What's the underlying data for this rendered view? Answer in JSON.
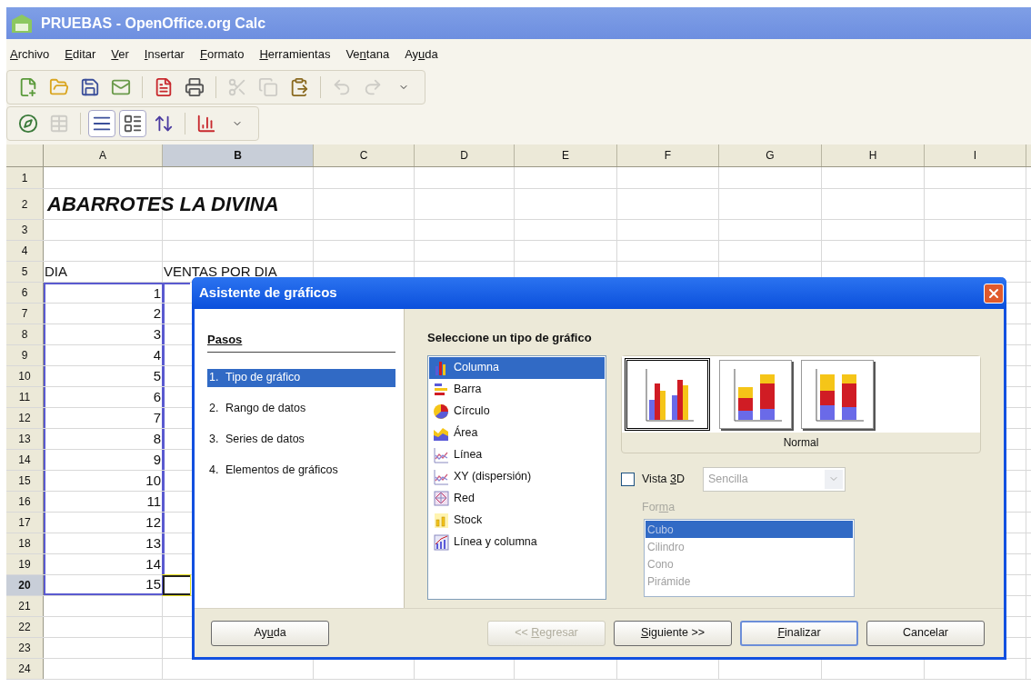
{
  "window": {
    "title": "PRUEBAS - OpenOffice.org Calc"
  },
  "menu": [
    {
      "key": "A",
      "post": "rchivo"
    },
    {
      "key": "E",
      "post": "ditar"
    },
    {
      "key": "V",
      "post": "er"
    },
    {
      "key": "I",
      "post": "nsertar"
    },
    {
      "key": "F",
      "post": "ormato"
    },
    {
      "key": "H",
      "post": "erramientas"
    },
    {
      "pre": "Ve",
      "key": "n",
      "post": "tana"
    },
    {
      "pre": "Ay",
      "key": "u",
      "post": "da"
    }
  ],
  "toolbar_standard": [
    {
      "kind": "new",
      "disabled": false
    },
    {
      "kind": "open",
      "disabled": false
    },
    {
      "kind": "save",
      "disabled": false
    },
    {
      "kind": "mail",
      "disabled": false
    },
    {
      "kind": "separator"
    },
    {
      "kind": "pdf",
      "disabled": false
    },
    {
      "kind": "print",
      "disabled": false
    },
    {
      "kind": "separator"
    },
    {
      "kind": "cut",
      "disabled": true
    },
    {
      "kind": "copy",
      "disabled": true
    },
    {
      "kind": "paste",
      "disabled": false
    },
    {
      "kind": "separator"
    },
    {
      "kind": "undo",
      "disabled": true
    },
    {
      "kind": "redo",
      "disabled": true
    },
    {
      "kind": "overflow",
      "disabled": false
    }
  ],
  "toolbar_form": [
    {
      "kind": "navigator",
      "pressed": false,
      "disabled": false
    },
    {
      "kind": "table",
      "pressed": false,
      "disabled": true
    },
    {
      "kind": "separator"
    },
    {
      "kind": "lines",
      "pressed": true,
      "disabled": false
    },
    {
      "kind": "form",
      "pressed": true,
      "disabled": false
    },
    {
      "kind": "sort",
      "pressed": false,
      "disabled": false
    },
    {
      "kind": "separator"
    },
    {
      "kind": "chart",
      "pressed": false,
      "disabled": false
    },
    {
      "kind": "overflow",
      "pressed": false,
      "disabled": false
    }
  ],
  "sheet": {
    "columns": [
      {
        "label": "A",
        "selected": false
      },
      {
        "label": "B",
        "selected": true
      },
      {
        "label": "C",
        "selected": false
      },
      {
        "label": "D",
        "selected": false
      },
      {
        "label": "E",
        "selected": false
      },
      {
        "label": "F",
        "selected": false
      },
      {
        "label": "G",
        "selected": false
      },
      {
        "label": "H",
        "selected": false
      },
      {
        "label": "I",
        "selected": false
      }
    ],
    "rows": [
      {
        "header": "1",
        "selected": false,
        "in_range": false,
        "cursor": false
      },
      {
        "header": "2",
        "selected": false,
        "in_range": false,
        "cursor": false,
        "kind": "title",
        "a": "ABARROTES LA DIVINA"
      },
      {
        "header": "3",
        "selected": false,
        "in_range": false,
        "cursor": false
      },
      {
        "header": "4",
        "selected": false,
        "in_range": false,
        "cursor": false
      },
      {
        "header": "5",
        "selected": false,
        "in_range": false,
        "cursor": false,
        "kind": "text",
        "a": "DIA",
        "b": "VENTAS POR DIA"
      },
      {
        "header": "6",
        "selected": false,
        "in_range": true,
        "cursor": false,
        "kind": "number",
        "a": "1"
      },
      {
        "header": "7",
        "selected": false,
        "in_range": true,
        "cursor": false,
        "kind": "number",
        "a": "2"
      },
      {
        "header": "8",
        "selected": false,
        "in_range": true,
        "cursor": false,
        "kind": "number",
        "a": "3"
      },
      {
        "header": "9",
        "selected": false,
        "in_range": true,
        "cursor": false,
        "kind": "number",
        "a": "4"
      },
      {
        "header": "10",
        "selected": false,
        "in_range": true,
        "cursor": false,
        "kind": "number",
        "a": "5"
      },
      {
        "header": "11",
        "selected": false,
        "in_range": true,
        "cursor": false,
        "kind": "number",
        "a": "6"
      },
      {
        "header": "12",
        "selected": false,
        "in_range": true,
        "cursor": false,
        "kind": "number",
        "a": "7"
      },
      {
        "header": "13",
        "selected": false,
        "in_range": true,
        "cursor": false,
        "kind": "number",
        "a": "8"
      },
      {
        "header": "14",
        "selected": false,
        "in_range": true,
        "cursor": false,
        "kind": "number",
        "a": "9"
      },
      {
        "header": "15",
        "selected": false,
        "in_range": true,
        "cursor": false,
        "kind": "number",
        "a": "10"
      },
      {
        "header": "16",
        "selected": false,
        "in_range": true,
        "cursor": false,
        "kind": "number",
        "a": "11"
      },
      {
        "header": "17",
        "selected": false,
        "in_range": true,
        "cursor": false,
        "kind": "number",
        "a": "12"
      },
      {
        "header": "18",
        "selected": false,
        "in_range": true,
        "cursor": false,
        "kind": "number",
        "a": "13"
      },
      {
        "header": "19",
        "selected": false,
        "in_range": true,
        "cursor": false,
        "kind": "number",
        "a": "14"
      },
      {
        "header": "20",
        "selected": true,
        "in_range": true,
        "cursor": true,
        "kind": "number",
        "a": "15"
      },
      {
        "header": "21",
        "selected": false,
        "in_range": false,
        "cursor": false
      },
      {
        "header": "22",
        "selected": false,
        "in_range": false,
        "cursor": false
      },
      {
        "header": "23",
        "selected": false,
        "in_range": false,
        "cursor": false
      },
      {
        "header": "24",
        "selected": false,
        "in_range": false,
        "cursor": false
      }
    ]
  },
  "dialog": {
    "title": "Asistente de gráficos",
    "steps_heading": "Pasos",
    "steps": [
      {
        "number": "1.",
        "label": "Tipo de gráfico",
        "selected": true
      },
      {
        "number": "2.",
        "label": "Rango de datos",
        "selected": false
      },
      {
        "number": "3.",
        "label": "Series de datos",
        "selected": false
      },
      {
        "number": "4.",
        "label": "Elementos de gráficos",
        "selected": false
      }
    ],
    "heading": "Seleccione un tipo de gráfico",
    "chart_types": [
      {
        "kind": "column",
        "label": "Columna",
        "selected": true
      },
      {
        "kind": "bar",
        "label": "Barra",
        "selected": false
      },
      {
        "kind": "pie",
        "label": "Círculo",
        "selected": false
      },
      {
        "kind": "area",
        "label": "Área",
        "selected": false
      },
      {
        "kind": "line",
        "label": "Línea",
        "selected": false
      },
      {
        "kind": "xy",
        "label": "XY (dispersión)",
        "selected": false
      },
      {
        "kind": "net",
        "label": "Red",
        "selected": false
      },
      {
        "kind": "stock",
        "label": "Stock",
        "selected": false
      },
      {
        "kind": "column_line",
        "label": "Línea y columna",
        "selected": false
      }
    ],
    "variants": [
      {
        "kind": "grouped",
        "selected": true
      },
      {
        "kind": "stacked",
        "selected": false
      },
      {
        "kind": "percent",
        "selected": false
      }
    ],
    "variant_label": "Normal",
    "view_3d": {
      "pre": "Vista ",
      "key": "3",
      "post": "D",
      "checked": false
    },
    "scheme": {
      "value": "Sencilla",
      "disabled": true
    },
    "shape_label": {
      "pre": "For",
      "key": "m",
      "post": "a",
      "disabled": true
    },
    "shapes": [
      {
        "label": "Cubo",
        "selected": true
      },
      {
        "label": "Cilindro",
        "selected": false
      },
      {
        "label": "Cono",
        "selected": false
      },
      {
        "label": "Pirámide",
        "selected": false
      }
    ],
    "shapes_disabled": true,
    "buttons": [
      {
        "kind": "help",
        "pre": "Ay",
        "key": "u",
        "post": "da",
        "disabled": false,
        "default": false
      },
      {
        "kind": "back",
        "pre": "<< ",
        "key": "R",
        "post": "egresar",
        "disabled": true,
        "default": false
      },
      {
        "kind": "next",
        "key": "S",
        "post": "iguiente >>",
        "disabled": false,
        "default": false
      },
      {
        "kind": "finish",
        "key": "F",
        "post": "inalizar",
        "disabled": false,
        "default": true
      },
      {
        "kind": "cancel",
        "post": "Cancelar",
        "disabled": false,
        "default": false
      }
    ]
  }
}
